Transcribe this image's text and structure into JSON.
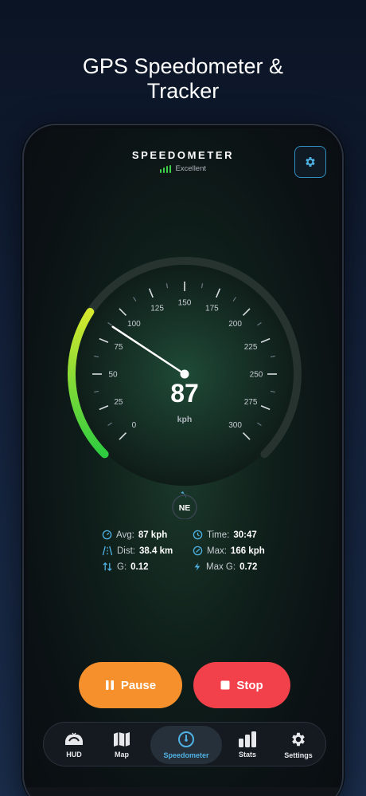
{
  "headline": {
    "line1": "GPS Speedometer &",
    "line2": "Tracker"
  },
  "header": {
    "title": "SPEEDOMETER",
    "signal_label": "Excellent",
    "settings_icon": "gear-icon"
  },
  "gauge": {
    "speed": "87",
    "unit": "kph",
    "needle_value": 87,
    "max_value": 300,
    "ticks": [
      "0",
      "25",
      "50",
      "75",
      "100",
      "125",
      "150",
      "175",
      "200",
      "225",
      "250",
      "275",
      "300"
    ],
    "compass": "NE",
    "arc_colors": [
      "#2ecc40",
      "#d6e82e"
    ]
  },
  "stats": {
    "avg_label": "Avg:",
    "avg_value": "87 kph",
    "time_label": "Time:",
    "time_value": "30:47",
    "dist_label": "Dist:",
    "dist_value": "38.4 km",
    "max_label": "Max:",
    "max_value": "166 kph",
    "g_label": "G:",
    "g_value": "0.12",
    "maxg_label": "Max G:",
    "maxg_value": "0.72"
  },
  "controls": {
    "pause_label": "Pause",
    "stop_label": "Stop"
  },
  "tabs": [
    {
      "label": "HUD",
      "icon": "car-icon"
    },
    {
      "label": "Map",
      "icon": "map-icon"
    },
    {
      "label": "Speedometer",
      "icon": "speedometer-icon"
    },
    {
      "label": "Stats",
      "icon": "bar-chart-icon"
    },
    {
      "label": "Settings",
      "icon": "gear-icon"
    }
  ],
  "colors": {
    "accent": "#4fb2e4",
    "pause": "#f5902c",
    "stop": "#f2414a"
  }
}
